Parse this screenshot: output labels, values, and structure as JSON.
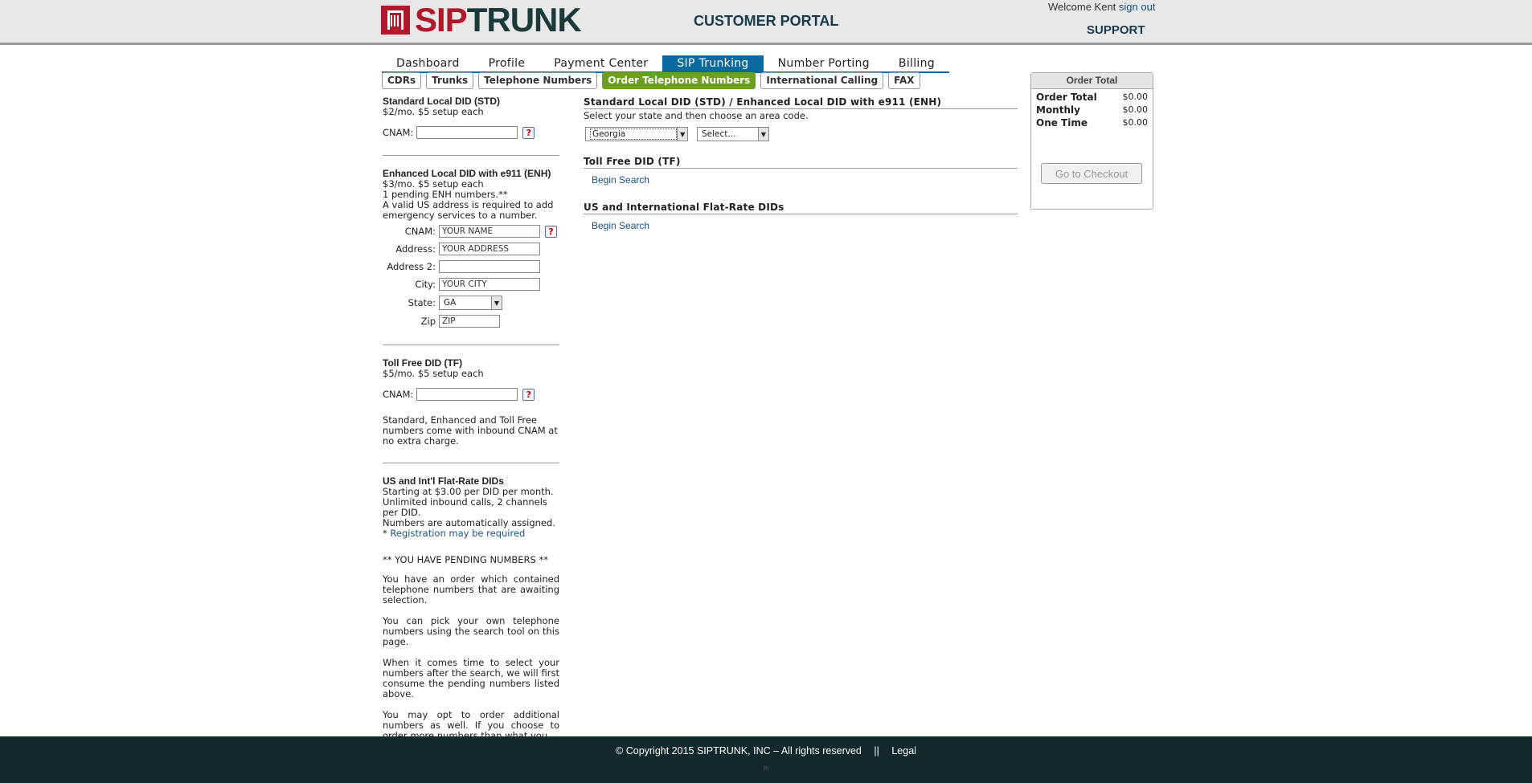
{
  "header": {
    "logo_sip": "SIP",
    "logo_trunk": "TRUNK",
    "portal_title": "CUSTOMER PORTAL",
    "welcome_text": "Welcome Kent",
    "sign_out": "sign out",
    "support": "SUPPORT"
  },
  "main_nav": [
    {
      "label": "Dashboard",
      "active": false
    },
    {
      "label": "Profile",
      "active": false
    },
    {
      "label": "Payment Center",
      "active": false
    },
    {
      "label": "SIP Trunking",
      "active": true
    },
    {
      "label": "Number Porting",
      "active": false
    },
    {
      "label": "Billing",
      "active": false
    }
  ],
  "sub_nav": [
    {
      "label": "CDRs",
      "active": false
    },
    {
      "label": "Trunks",
      "active": false
    },
    {
      "label": "Telephone Numbers",
      "active": false
    },
    {
      "label": "Order Telephone Numbers",
      "active": true
    },
    {
      "label": "International Calling",
      "active": false
    },
    {
      "label": "FAX",
      "active": false
    }
  ],
  "left": {
    "std": {
      "title": "Standard Local DID (STD)",
      "price": "$2/mo. $5 setup each",
      "cnam_label": "CNAM:",
      "cnam_value": ""
    },
    "enh": {
      "title": "Enhanced Local DID with e911 (ENH)",
      "price": "$3/mo. $5 setup each",
      "pending": "1 pending ENH numbers.**",
      "notice": "A valid US address is required to add emergency services to a number.",
      "cnam_label": "CNAM:",
      "cnam_value": "YOUR NAME",
      "address_label": "Address:",
      "address_value": "YOUR ADDRESS",
      "address2_label": "Address 2:",
      "address2_value": "",
      "city_label": "City:",
      "city_value": "YOUR CITY",
      "state_label": "State:",
      "state_value": "GA",
      "zip_label": "Zip",
      "zip_value": "ZIP"
    },
    "tf": {
      "title": "Toll Free DID (TF)",
      "price": "$5/mo. $5 setup each",
      "cnam_label": "CNAM:",
      "cnam_value": "",
      "note": "Standard, Enhanced and Toll Free numbers come with inbound CNAM at no extra charge."
    },
    "flat": {
      "title": "US and Int'l Flat-Rate DIDs",
      "line1": "Starting at $3.00 per DID per month.",
      "line2": "Unlimited inbound calls, 2 channels per DID.",
      "line3": "Numbers are automatically assigned.",
      "reg_prefix": "* ",
      "reg_link": "Registration may be required"
    },
    "pending": {
      "heading": "** YOU HAVE PENDING NUMBERS **",
      "p1": "You have an order which contained telephone numbers that are awaiting selection.",
      "p2": "You can pick your own telephone numbers using the search tool on this page.",
      "p3": "When it comes time to select your numbers after the search, we will first consume the pending numbers listed above.",
      "p4": "You may opt to order additional numbers as well. If you choose to order more numbers than what you"
    },
    "help_glyph": "?"
  },
  "middle": {
    "std_heading": "Standard Local DID (STD) / Enhanced Local DID with e911 (ENH)",
    "std_instruction": "Select your state and then choose an area code.",
    "state_select": "Georgia",
    "area_select": "Select...",
    "tf_heading": "Toll Free DID (TF)",
    "tf_begin": "Begin Search",
    "flat_heading": "US and International Flat-Rate DIDs",
    "flat_begin": "Begin Search"
  },
  "order": {
    "title": "Order Total",
    "rows": [
      {
        "label": "Order Total",
        "value": "$0.00"
      },
      {
        "label": "Monthly",
        "value": "$0.00"
      },
      {
        "label": "One Time",
        "value": "$0.00"
      }
    ],
    "checkout": "Go to Checkout"
  },
  "footer": {
    "copyright": "© Copyright 2015 SIPTRUNK, INC – All rights reserved",
    "separator": "||",
    "legal": "Legal",
    "mark": "Pi"
  },
  "colors": {
    "brand_red": "#b0192b",
    "nav_active": "#0a6aa0",
    "subnav_active": "#6aa01e",
    "footer_bg": "#12292c",
    "link": "#1a4f8b"
  },
  "icons": [
    "siptrunk-logo-icon",
    "help-icon",
    "dropdown-arrow-icon"
  ]
}
